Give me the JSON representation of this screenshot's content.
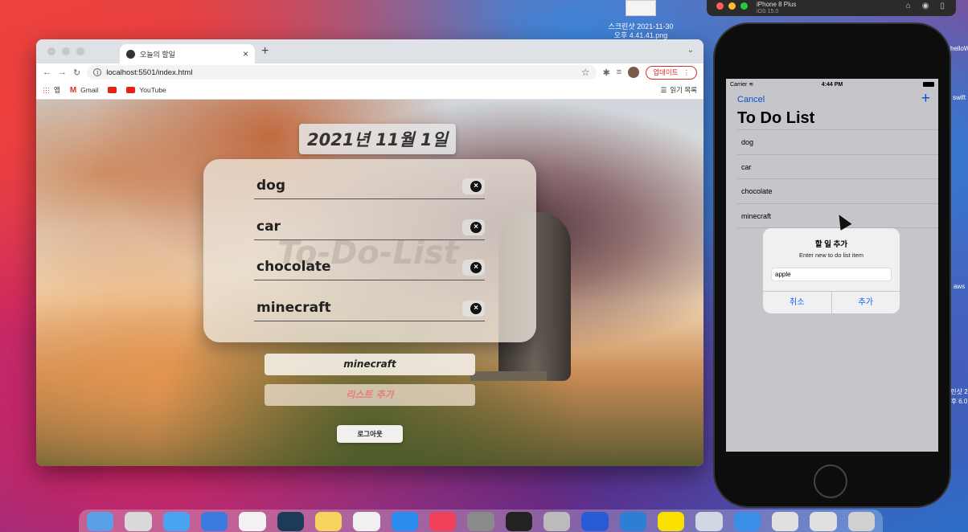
{
  "desktop": {
    "file_label": "스크린샷 2021-11-30",
    "file_label2": "오후 4.41.41.png",
    "edge_top": "helloW",
    "edge_mid": "swift",
    "edge_aws": "aws",
    "edge_low1": "린샷 2",
    "edge_low2": "후 6.0"
  },
  "browser": {
    "tab_title": "오늘의 할일",
    "url": "localhost:5501/index.html",
    "update_label": "업데이트",
    "bookmarks": {
      "apps": "앱",
      "gmail": "Gmail",
      "youtube": "YouTube",
      "reading_list": "읽기 목록"
    }
  },
  "todo_page": {
    "date_title": "2021년 11월 1일",
    "watermark": "To-Do-List",
    "items": [
      "dog",
      "car",
      "chocolate",
      "minecraft"
    ],
    "input_value": "minecraft",
    "add_button": "리스트 추가",
    "logout_button": "로그아웃"
  },
  "simulator": {
    "device_name": "iPhone 8 Plus",
    "os_version": "iOS 15.0",
    "status": {
      "carrier": "Carrier",
      "time": "4:44 PM"
    },
    "nav": {
      "cancel": "Cancel",
      "add": "+"
    },
    "title": "To Do List",
    "items": [
      "dog",
      "car",
      "chocolate",
      "minecraft"
    ],
    "alert": {
      "title": "할 일 추가",
      "message": "Enter new to do list item",
      "input_value": "apple",
      "cancel": "취소",
      "confirm": "추가"
    }
  },
  "colors": {
    "ios_blue": "#0a60ff",
    "add_button_text": "#e87a80",
    "update_red": "#d93025"
  }
}
